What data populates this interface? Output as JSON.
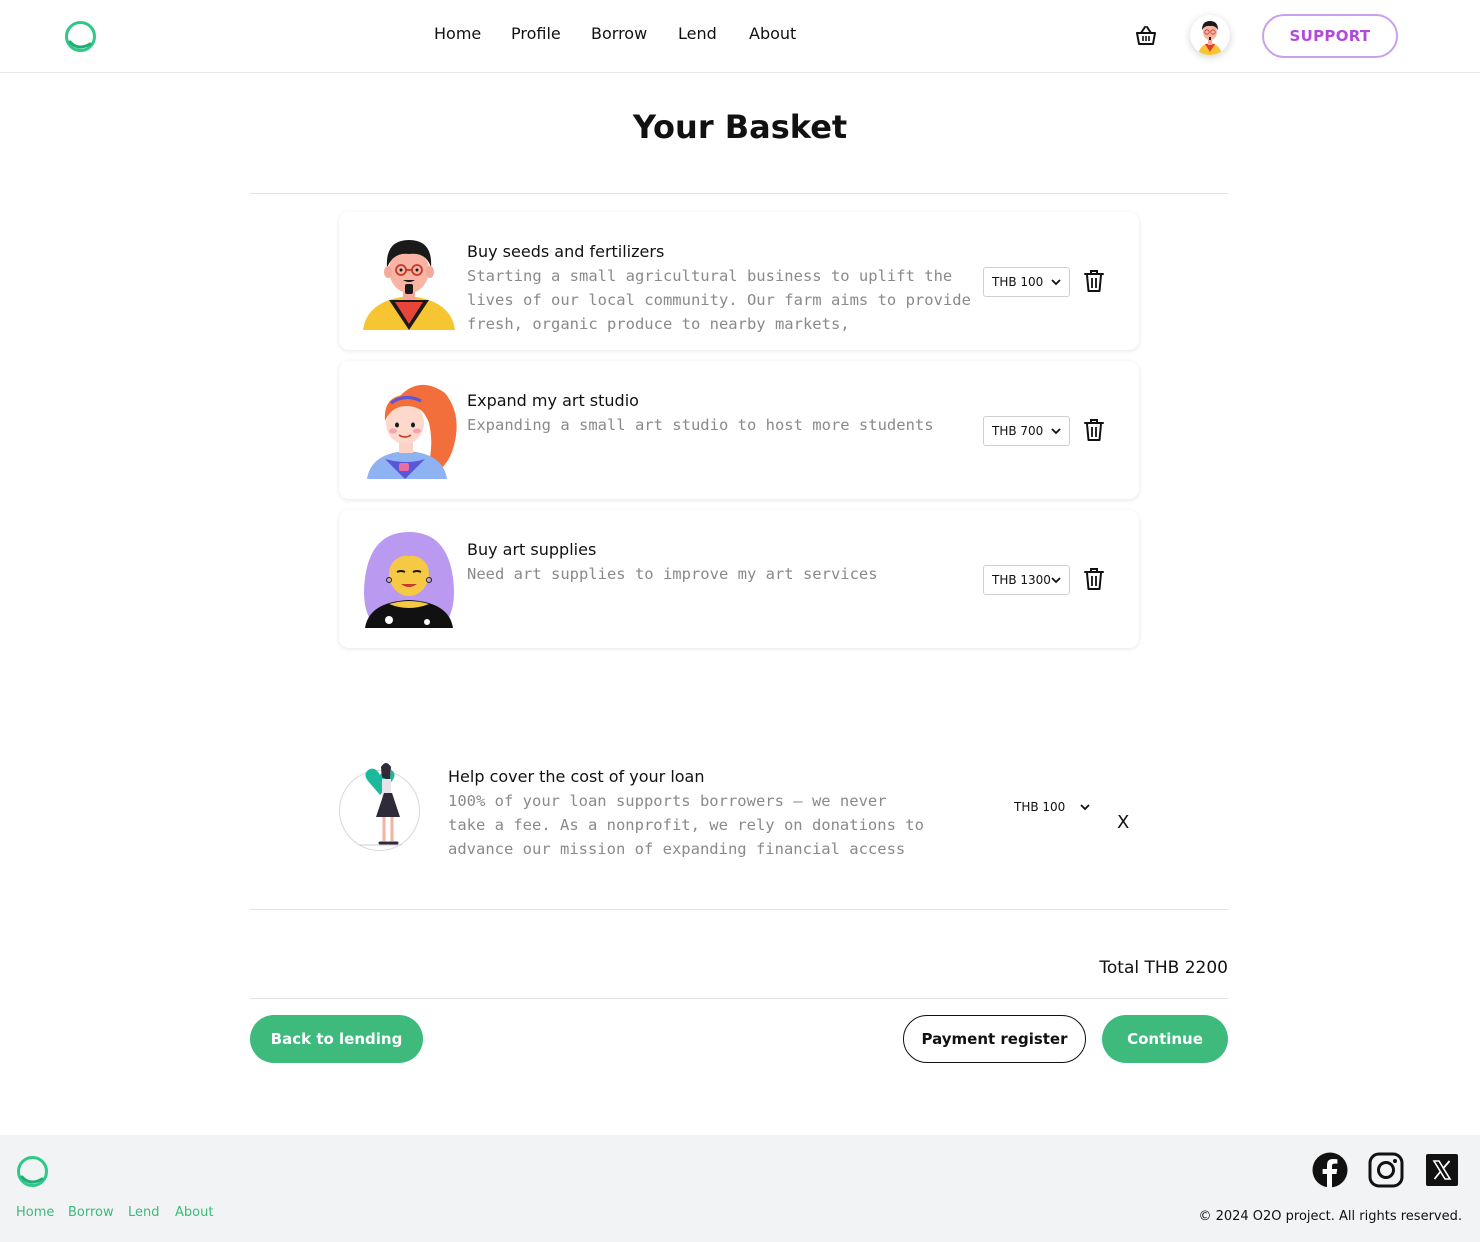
{
  "header": {
    "logo_icon": "ring-logo-icon",
    "nav": [
      "Home",
      "Profile",
      "Borrow",
      "Lend",
      "About"
    ],
    "basket_icon": "basket-icon",
    "avatar": "user-avatar",
    "support_label": "SUPPORT"
  },
  "page": {
    "title": "Your Basket"
  },
  "items": [
    {
      "title": "Buy seeds and fertilizers",
      "description": "Starting a small agricultural business to uplift the lives of our local community. Our farm aims to provide fresh, organic produce to nearby markets,",
      "amount": "THB 100",
      "delete_icon": "trash-icon"
    },
    {
      "title": "Expand my art studio",
      "description": "Expanding a small art studio to host more students",
      "amount": "THB 700",
      "delete_icon": "trash-icon"
    },
    {
      "title": "Buy art supplies",
      "description": "Need art supplies to improve my art services",
      "amount": "THB 1300",
      "delete_icon": "trash-icon"
    }
  ],
  "donation": {
    "title": "Help cover the cost of your loan",
    "description": "100% of your loan supports borrowers — we never take a fee. As a nonprofit, we rely on donations to advance our mission of expanding financial access",
    "amount": "THB 100",
    "close_label": "X"
  },
  "summary": {
    "total": "Total THB 2200"
  },
  "actions": {
    "back_label": "Back to lending",
    "payment_label": "Payment register",
    "continue_label": "Continue"
  },
  "footer": {
    "links": [
      "Home",
      "Borrow",
      "Lend",
      "About"
    ],
    "social": [
      "facebook-icon",
      "instagram-icon",
      "x-icon"
    ],
    "copyright": "© 2024 O2O project. All rights reserved."
  },
  "colors": {
    "brand_green": "#3dba7c",
    "support_text": "#b04bd9",
    "support_border": "#c9a0ea",
    "footer_bg": "#f1f3f5"
  }
}
